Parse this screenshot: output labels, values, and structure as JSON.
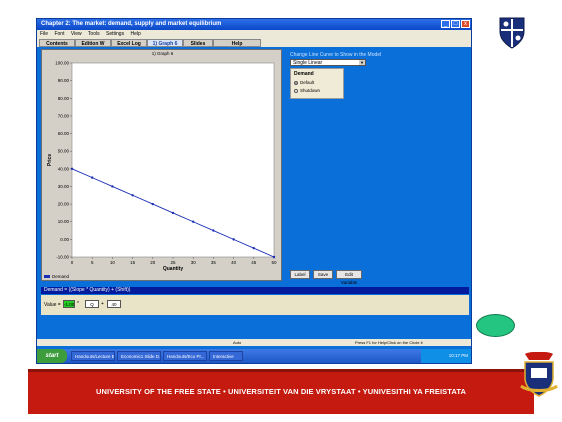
{
  "window": {
    "title": "Chapter 2: The market: demand, supply and market equilibrium",
    "controls": [
      "_",
      "□",
      "x"
    ],
    "menu": [
      "File",
      "Font",
      "View",
      "Tools",
      "Settings",
      "Help"
    ],
    "tabs": [
      "Contents",
      "Edition W",
      "Excel Log",
      "1) Graph 6",
      "Slides",
      "Help"
    ],
    "active_tab": "1) Graph 6"
  },
  "graph": {
    "title": "1) Graph 6",
    "legend": "Demand"
  },
  "chart_data": {
    "type": "line",
    "title": "1) Graph 6",
    "xlabel": "Quantity",
    "ylabel": "Price",
    "x": [
      0,
      5,
      10,
      15,
      20,
      25,
      30,
      35,
      40,
      45,
      50
    ],
    "series": [
      {
        "name": "Demand",
        "values": [
          40,
          35,
          30,
          25,
          20,
          15,
          10,
          5,
          0,
          -5,
          -10
        ]
      }
    ],
    "xticks": [
      "0",
      "5",
      "10",
      "15",
      "20",
      "25",
      "30",
      "35",
      "40",
      "45",
      "50"
    ],
    "yticks": [
      "100.00",
      "90.00",
      "80.00",
      "70.00",
      "60.00",
      "50.00",
      "40.00",
      "30.00",
      "20.00",
      "10.00",
      "0.00",
      "-10.00"
    ],
    "xlim": [
      0,
      50
    ],
    "ylim": [
      -10,
      100
    ],
    "grid": false,
    "legend": "bottom-left",
    "line_color": "#1b2fb5"
  },
  "controls": {
    "curve_label": "Change Line Curve to Show in the Model",
    "curve_select": "Single Linear",
    "demand_title": "Demand",
    "option_default": "Default",
    "option_shutdown": "Shutdown",
    "label_button": "Label",
    "save_button": "Save",
    "edit_variable_button": "Edit Variable"
  },
  "equation": {
    "text": "Demand = ((Slope * Quantity) + (Shift))",
    "value_label": "Value =",
    "value_green": "-1.00",
    "multiply_symbol": "*",
    "quantity_value": "Q",
    "plus_symbol": "+",
    "shift_value": "40"
  },
  "statusbar": {
    "center": "Auto",
    "right": "Press F1 for Help/Click on the Circle it"
  },
  "taskbar": {
    "start_label": "start",
    "tasks": [
      "Handouts/Lecture Eco...",
      "Economic1 Slide D...",
      "Handouts/Eco Pr...",
      "Interactive"
    ],
    "tray_time": "10:17 PM"
  },
  "footer": {
    "text": "UNIVERSITY OF THE FREE STATE • UNIVERSITEIT VAN DIE VRYSTAAT • YUNIVESITHI YA FREISTATA"
  },
  "colors": {
    "window_blue": "#0a6fd8",
    "footer_red": "#c41a10",
    "oval_green": "#24c481",
    "value_green": "#22cc22"
  }
}
